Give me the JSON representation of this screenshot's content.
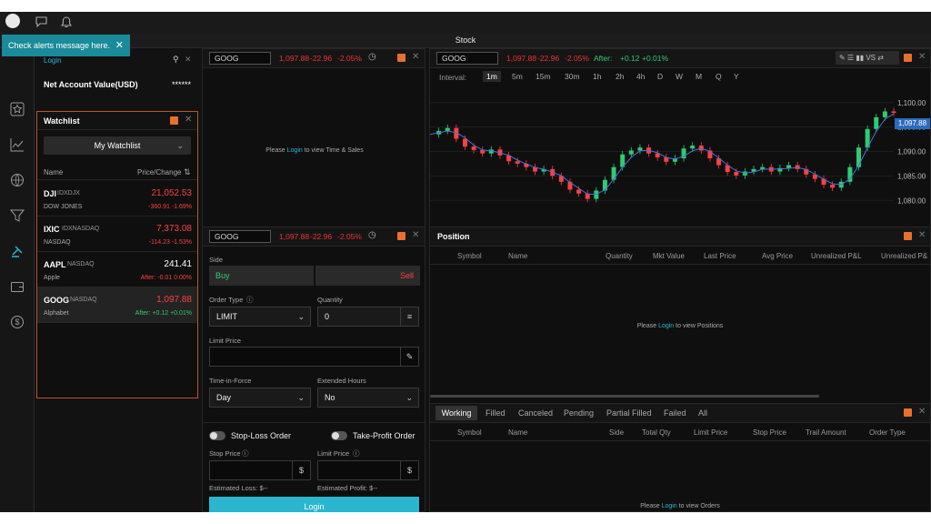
{
  "topbar": {
    "logo": "app-logo",
    "icons": [
      "chat-icon",
      "bell-icon"
    ]
  },
  "stockbar": {
    "title": "Stock"
  },
  "toast": {
    "text": "Check alerts message here.",
    "close": "✕"
  },
  "sidebar": {
    "icons": [
      "star-icon",
      "line-chart-icon",
      "globe-icon",
      "filter-icon",
      "trade-icon",
      "wallet-icon",
      "dollar-icon"
    ]
  },
  "account": {
    "login": "Login",
    "net_label": "Net Account Value(USD)",
    "net_value": "******"
  },
  "watchlist": {
    "title": "Watchlist",
    "dropdown": "My Watchlist",
    "col_name": "Name",
    "col_price": "Price/Change",
    "rows": [
      {
        "sym": "DJI",
        "ex": "IDXDJX",
        "price": "21,052.53",
        "desc": "DOW JONES",
        "change": "-360.91 -1.69%",
        "pcolor": "red"
      },
      {
        "sym": "IXIC",
        "ex": "IDXNASDAQ",
        "price": "7,373.08",
        "desc": "NASDAQ",
        "change": "-114.23 -1.53%",
        "pcolor": "red"
      },
      {
        "sym": "AAPL",
        "ex": "NASDAQ",
        "price": "241.41",
        "desc": "Apple",
        "change": "After: -0.01  0.00%",
        "pcolor": "white"
      },
      {
        "sym": "GOOG",
        "ex": "NASDAQ",
        "price": "1,097.88",
        "desc": "Alphabet",
        "change": "After: +0.12  +0.01%",
        "pcolor": "red"
      }
    ]
  },
  "quote": {
    "symbol": "GOOG",
    "price": "1,097.88",
    "change": "-22.96",
    "pct": "-2.05%",
    "after_label": "After:",
    "after_change": "+0.12",
    "after_pct": "+0.01%"
  },
  "time_sales": {
    "please": "Please",
    "login": "Login",
    "rest": "to view Time & Sales"
  },
  "order": {
    "side_label": "Side",
    "buy": "Buy",
    "sell": "Sell",
    "order_type_label": "Order Type",
    "order_type": "LIMIT",
    "quantity_label": "Quantity",
    "quantity": "0",
    "limit_price_label": "Limit Price",
    "tif_label": "Time-in-Force",
    "tif": "Day",
    "ext_label": "Extended Hours",
    "ext": "No",
    "stop_loss": "Stop-Loss Order",
    "take_profit": "Take-Profit Order",
    "stop_price_label": "Stop Price",
    "limit_price_label2": "Limit Price",
    "est_loss": "Estimated Loss: $--",
    "est_profit": "Estimated Profit: $--",
    "dollar": "$",
    "login_btn": "Login"
  },
  "chart": {
    "interval_label": "Interval:",
    "intervals": [
      "1m",
      "5m",
      "15m",
      "30m",
      "1h",
      "2h",
      "4h",
      "D",
      "W",
      "M",
      "Q",
      "Y"
    ],
    "active_interval": "1m",
    "y_ticks": [
      "1,100.00",
      "1,095.00",
      "1,090.00",
      "1,085.00",
      "1,080.00"
    ],
    "current_label": "1,097.88"
  },
  "chart_data": {
    "type": "line",
    "title": "",
    "ylim": [
      1078,
      1102
    ],
    "y": [
      1093.5,
      1094.2,
      1094.8,
      1092.6,
      1091,
      1090.3,
      1089.6,
      1090.4,
      1089.2,
      1088,
      1087.5,
      1086.8,
      1085.9,
      1086.4,
      1085,
      1083.8,
      1082.2,
      1081.4,
      1080.3,
      1082,
      1084.2,
      1086.8,
      1089.4,
      1090.2,
      1090.8,
      1089.6,
      1088.8,
      1087.9,
      1088.6,
      1090.6,
      1091.2,
      1090.2,
      1088.6,
      1087.2,
      1085.8,
      1085.1,
      1085.9,
      1086.4,
      1086.8,
      1085.9,
      1086.6,
      1087.2,
      1086.4,
      1085.3,
      1084.4,
      1083.2,
      1082.6,
      1083.8,
      1086.8,
      1090.8,
      1094.6,
      1097,
      1098.2,
      1097.9
    ]
  },
  "position": {
    "title": "Position",
    "cols": [
      "Symbol",
      "Name",
      "Quantity",
      "Mkt Value",
      "Last Price",
      "Avg Price",
      "Unrealized P&L",
      "Unrealized P&"
    ],
    "please": "Please",
    "login": "Login",
    "rest": "to view Positions"
  },
  "orders": {
    "tabs": [
      "Working",
      "Filled",
      "Canceled",
      "Pending",
      "Partial Filled",
      "Failed",
      "All"
    ],
    "cols": [
      "Symbol",
      "Name",
      "Side",
      "Total Qty",
      "Limit Price",
      "Stop Price",
      "Trail Amount",
      "Order Type"
    ],
    "please": "Please",
    "login": "Login",
    "rest": "to view Orders"
  },
  "colors": {
    "accent": "#2bb6d0",
    "up": "#2ecc71",
    "down": "#ff4040",
    "alert": "#e8702a",
    "highlight": "#e8702a"
  }
}
